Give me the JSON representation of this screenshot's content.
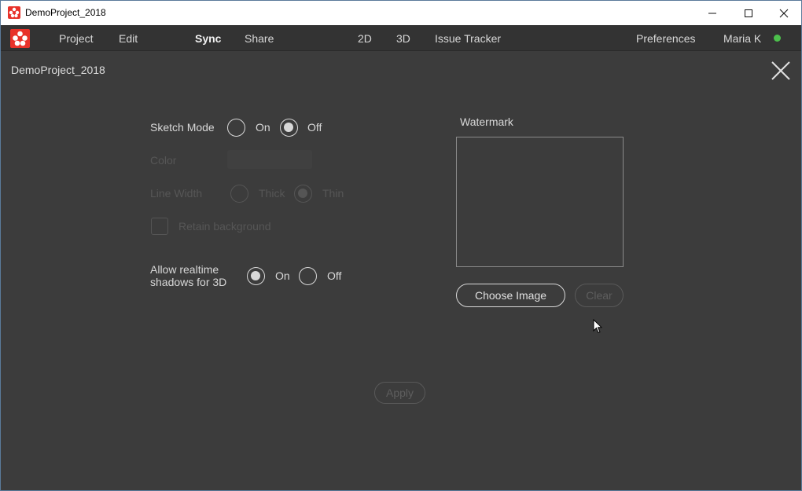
{
  "window": {
    "title": "DemoProject_2018"
  },
  "menubar": {
    "items": [
      "Project",
      "Edit",
      "Sync",
      "Share",
      "2D",
      "3D",
      "Issue Tracker",
      "Preferences",
      "Maria K"
    ],
    "active": "Sync",
    "status_color": "#4cc04c"
  },
  "panel": {
    "project_name": "DemoProject_2018"
  },
  "settings": {
    "sketch_mode": {
      "label": "Sketch Mode",
      "on": "On",
      "off": "Off",
      "selected": "Off"
    },
    "color": {
      "label": "Color"
    },
    "line_width": {
      "label": "Line Width",
      "thick": "Thick",
      "thin": "Thin",
      "selected": "Thin"
    },
    "retain_background": {
      "label": "Retain background",
      "checked": false
    },
    "shadows": {
      "label_line1": "Allow realtime",
      "label_line2": "shadows for 3D",
      "on": "On",
      "off": "Off",
      "selected": "On"
    }
  },
  "watermark": {
    "label": "Watermark",
    "choose_label": "Choose Image",
    "clear_label": "Clear"
  },
  "apply_label": "Apply",
  "colors": {
    "background": "#3c3c3c",
    "menubar": "#333333",
    "accent": "#e8322a",
    "text": "#d8d8d8",
    "disabled": "#565656"
  }
}
